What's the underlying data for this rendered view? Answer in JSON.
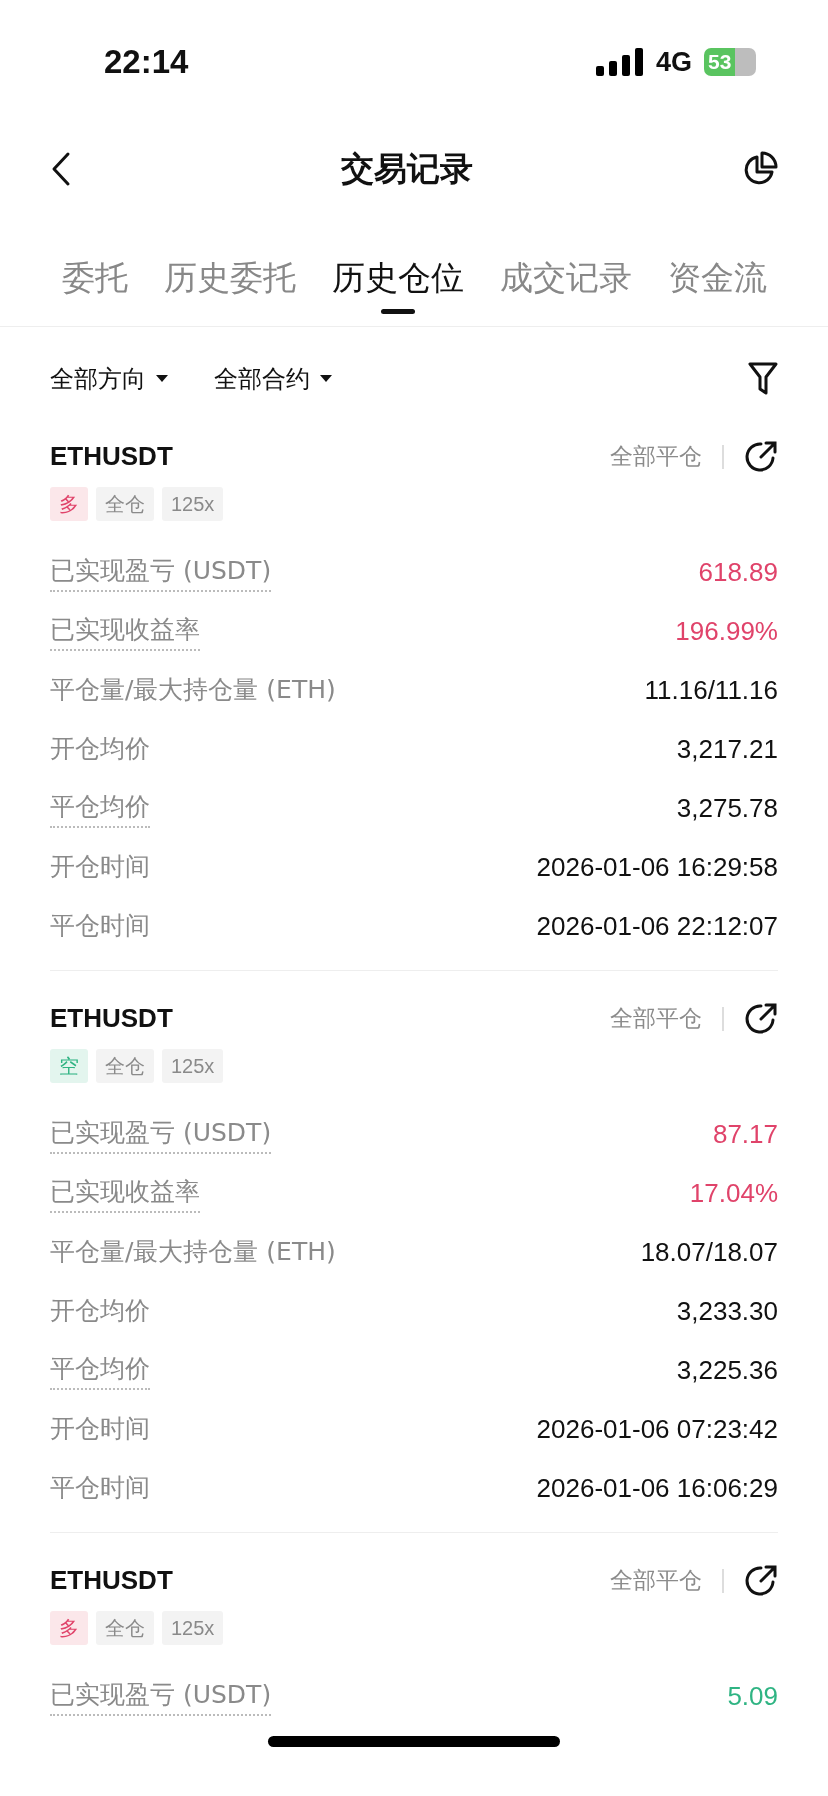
{
  "status_bar": {
    "time": "22:14",
    "network": "4G",
    "battery": "53"
  },
  "header": {
    "title": "交易记录"
  },
  "tabs": [
    {
      "label": "委托",
      "selected": false
    },
    {
      "label": "历史委托",
      "selected": false
    },
    {
      "label": "历史仓位",
      "selected": true
    },
    {
      "label": "成交记录",
      "selected": false
    },
    {
      "label": "资金流",
      "selected": false
    }
  ],
  "filters": [
    {
      "label": "全部方向"
    },
    {
      "label": "全部合约"
    }
  ],
  "positions": [
    {
      "symbol": "ETHUSDT",
      "action": "全部平仓",
      "tags": [
        {
          "text": "多",
          "kind": "long"
        },
        {
          "text": "全仓",
          "kind": "plain"
        },
        {
          "text": "125x",
          "kind": "plain"
        }
      ],
      "rows": [
        {
          "label": "已实现盈亏 (USDT)",
          "value": "618.89",
          "kind": "gain",
          "dotted": true
        },
        {
          "label": "已实现收益率",
          "value": "196.99%",
          "kind": "gain",
          "dotted": true
        },
        {
          "label": "平仓量/最大持仓量 (ETH)",
          "value": "11.16/11.16",
          "kind": "plain",
          "dotted": false
        },
        {
          "label": "开仓均价",
          "value": "3,217.21",
          "kind": "plain",
          "dotted": false
        },
        {
          "label": "平仓均价",
          "value": "3,275.78",
          "kind": "plain",
          "dotted": true
        },
        {
          "label": "开仓时间",
          "value": "2026-01-06 16:29:58",
          "kind": "plain",
          "dotted": false
        },
        {
          "label": "平仓时间",
          "value": "2026-01-06 22:12:07",
          "kind": "plain",
          "dotted": false
        }
      ]
    },
    {
      "symbol": "ETHUSDT",
      "action": "全部平仓",
      "tags": [
        {
          "text": "空",
          "kind": "short"
        },
        {
          "text": "全仓",
          "kind": "plain"
        },
        {
          "text": "125x",
          "kind": "plain"
        }
      ],
      "rows": [
        {
          "label": "已实现盈亏 (USDT)",
          "value": "87.17",
          "kind": "gain",
          "dotted": true
        },
        {
          "label": "已实现收益率",
          "value": "17.04%",
          "kind": "gain",
          "dotted": true
        },
        {
          "label": "平仓量/最大持仓量 (ETH)",
          "value": "18.07/18.07",
          "kind": "plain",
          "dotted": false
        },
        {
          "label": "开仓均价",
          "value": "3,233.30",
          "kind": "plain",
          "dotted": false
        },
        {
          "label": "平仓均价",
          "value": "3,225.36",
          "kind": "plain",
          "dotted": true
        },
        {
          "label": "开仓时间",
          "value": "2026-01-06 07:23:42",
          "kind": "plain",
          "dotted": false
        },
        {
          "label": "平仓时间",
          "value": "2026-01-06 16:06:29",
          "kind": "plain",
          "dotted": false
        }
      ]
    },
    {
      "symbol": "ETHUSDT",
      "action": "全部平仓",
      "tags": [
        {
          "text": "多",
          "kind": "long"
        },
        {
          "text": "全仓",
          "kind": "plain"
        },
        {
          "text": "125x",
          "kind": "plain"
        }
      ],
      "rows": [
        {
          "label": "已实现盈亏 (USDT)",
          "value": "5.09",
          "kind": "loss",
          "dotted": true
        }
      ]
    }
  ]
}
